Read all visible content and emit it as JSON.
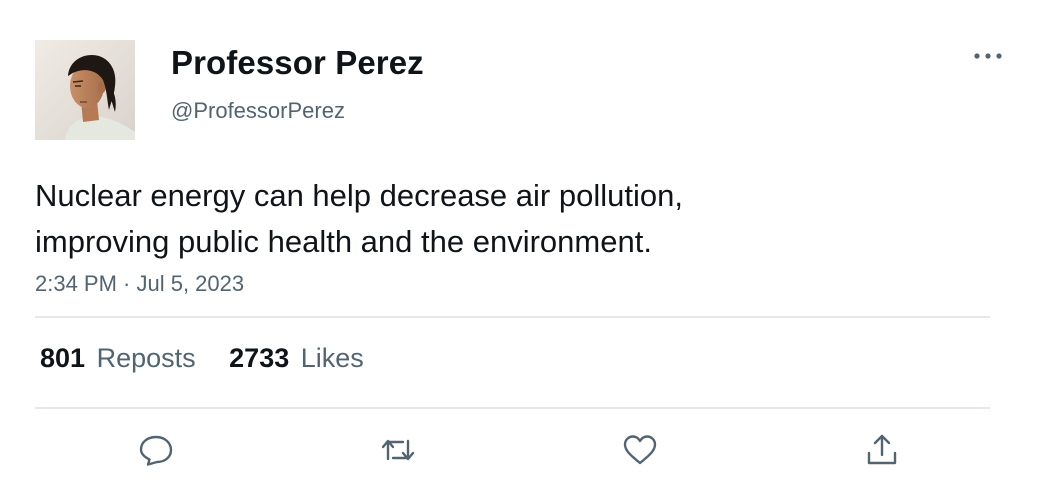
{
  "author": {
    "display_name": "Professor Perez",
    "handle": "@ProfessorPerez"
  },
  "tweet": {
    "text_lines": [
      "Nuclear energy can help decrease air pollution,",
      "improving public health and the environment."
    ],
    "timestamp": "2:34 PM · Jul 5, 2023"
  },
  "stats": {
    "reposts_count": "801",
    "reposts_label": "Reposts",
    "likes_count": "2733",
    "likes_label": "Likes"
  },
  "icons": {
    "more": "more-horizontal-icon",
    "reply": "reply-bubble-icon",
    "repost": "repost-arrows-icon",
    "like": "heart-icon",
    "share": "share-upload-icon"
  },
  "colors": {
    "text_primary": "#0f1419",
    "text_secondary": "#536471",
    "divider": "#e6e9ec",
    "icon": "#536471"
  }
}
